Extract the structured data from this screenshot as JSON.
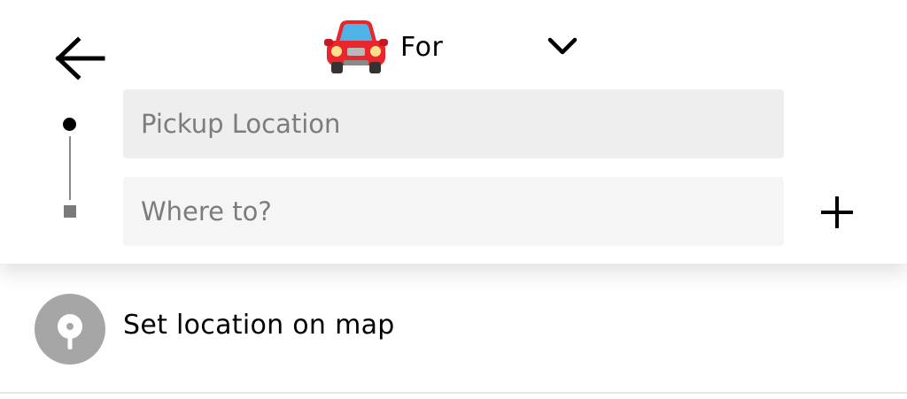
{
  "header": {
    "title": "For",
    "vehicle_icon": "car-icon",
    "back_icon": "arrow-left-icon",
    "dropdown_icon": "chevron-down-icon"
  },
  "route": {
    "pickup_placeholder": "Pickup Location",
    "pickup_value": "",
    "destination_placeholder": "Where to?",
    "destination_value": "",
    "add_stop_icon": "plus-icon"
  },
  "suggestions": {
    "set_on_map_label": "Set location on map",
    "set_on_map_icon": "map-pin-icon"
  },
  "colors": {
    "pickup_field_bg": "#eeeeee",
    "destination_field_bg": "#f5f5f5",
    "pin_circle": "#a6a6a6",
    "car_body": "#e8262b"
  }
}
